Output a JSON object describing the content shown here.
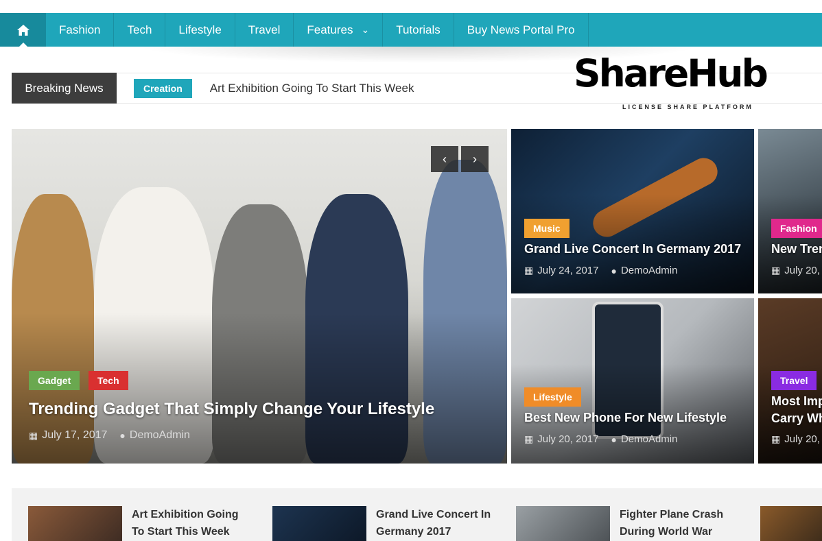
{
  "nav": {
    "home_icon": "home-icon",
    "items": [
      {
        "label": "Fashion"
      },
      {
        "label": "Tech"
      },
      {
        "label": "Lifestyle"
      },
      {
        "label": "Travel"
      },
      {
        "label": "Features",
        "has_dropdown": true
      },
      {
        "label": "Tutorials"
      },
      {
        "label": "Buy News Portal Pro"
      }
    ],
    "color": "#1fa6ba"
  },
  "breaking": {
    "label": "Breaking News",
    "category": "Creation",
    "title": "Art Exhibition Going To Start This Week"
  },
  "logo": {
    "text": "ShareHub",
    "subtitle": "LICENSE SHARE PLATFORM"
  },
  "featured": {
    "main": {
      "tags": [
        {
          "label": "Gadget",
          "color": "#6aa84f"
        },
        {
          "label": "Tech",
          "color": "#d93030"
        }
      ],
      "title": "Trending Gadget That Simply Change Your Lifestyle",
      "date": "July 17, 2017",
      "author": "DemoAdmin",
      "prev_icon": "chevron-left-icon",
      "next_icon": "chevron-right-icon"
    },
    "cards": [
      {
        "tag": "Music",
        "tag_color": "#f0a030",
        "title": "Grand Live Concert In Germany 2017",
        "date": "July 24, 2017",
        "author": "DemoAdmin"
      },
      {
        "tag": "Fashion",
        "tag_color": "#e0288c",
        "title": "New Tren",
        "date": "July 20,"
      },
      {
        "tag": "Lifestyle",
        "tag_color": "#f08c28",
        "title": "Best New Phone For New Lifestyle",
        "date": "July 20, 2017",
        "author": "DemoAdmin"
      },
      {
        "tag": "Travel",
        "tag_color": "#8a2be2",
        "title_line1": "Most Imp",
        "title_line2": "Carry Wh",
        "date": "July 20,"
      }
    ]
  },
  "bottom_list": [
    {
      "title_line1": "Art Exhibition Going",
      "title_line2": "To Start This Week"
    },
    {
      "title_line1": "Grand Live Concert In",
      "title_line2": "Germany 2017"
    },
    {
      "title_line1": "Fighter Plane Crash",
      "title_line2": "During World War"
    }
  ]
}
